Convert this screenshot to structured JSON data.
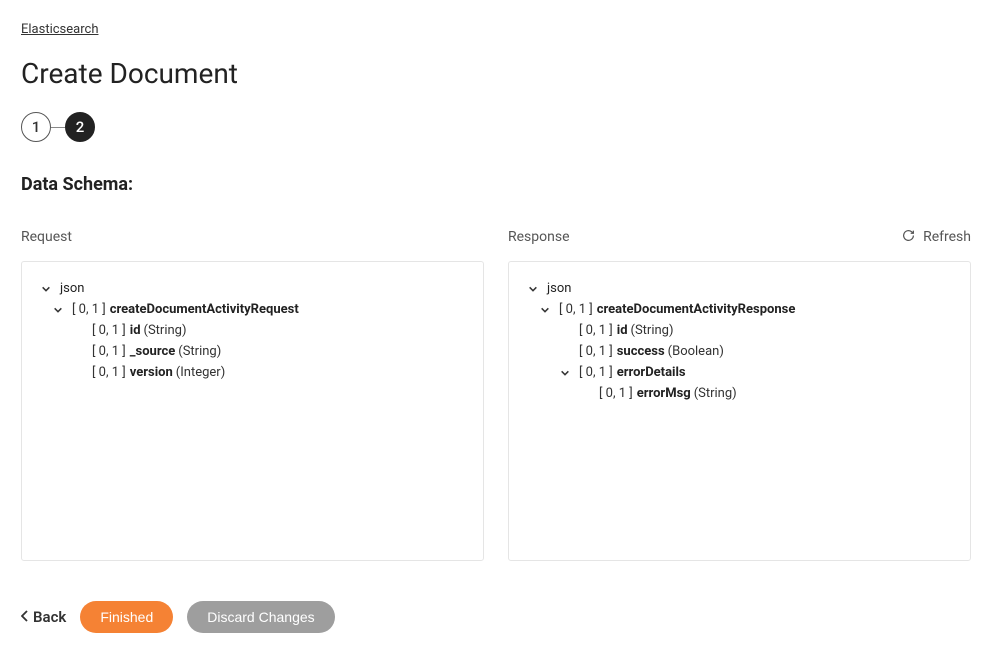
{
  "breadcrumb": "Elasticsearch",
  "page_title": "Create Document",
  "stepper": {
    "step1": "1",
    "step2": "2"
  },
  "section_title": "Data Schema:",
  "request_label": "Request",
  "response_label": "Response",
  "refresh_label": "Refresh",
  "request_tree": [
    {
      "indent": 0,
      "toggle": true,
      "card": "",
      "name": "json",
      "type": ""
    },
    {
      "indent": 1,
      "toggle": true,
      "card": "[ 0, 1 ]",
      "name": "createDocumentActivityRequest",
      "type": ""
    },
    {
      "indent": 2,
      "toggle": false,
      "card": "[ 0, 1 ]",
      "name": "id",
      "type": "(String)"
    },
    {
      "indent": 2,
      "toggle": false,
      "card": "[ 0, 1 ]",
      "name": "_source",
      "type": "(String)"
    },
    {
      "indent": 2,
      "toggle": false,
      "card": "[ 0, 1 ]",
      "name": "version",
      "type": "(Integer)"
    }
  ],
  "response_tree": [
    {
      "indent": 0,
      "toggle": true,
      "card": "",
      "name": "json",
      "type": ""
    },
    {
      "indent": 1,
      "toggle": true,
      "card": "[ 0, 1 ]",
      "name": "createDocumentActivityResponse",
      "type": ""
    },
    {
      "indent": 2,
      "toggle": false,
      "card": "[ 0, 1 ]",
      "name": "id",
      "type": "(String)"
    },
    {
      "indent": 2,
      "toggle": false,
      "card": "[ 0, 1 ]",
      "name": "success",
      "type": "(Boolean)"
    },
    {
      "indent": 2,
      "toggle": true,
      "card": "[ 0, 1 ]",
      "name": "errorDetails",
      "type": ""
    },
    {
      "indent": 3,
      "toggle": false,
      "card": "[ 0, 1 ]",
      "name": "errorMsg",
      "type": "(String)"
    }
  ],
  "footer": {
    "back": "Back",
    "finished": "Finished",
    "discard": "Discard Changes"
  }
}
